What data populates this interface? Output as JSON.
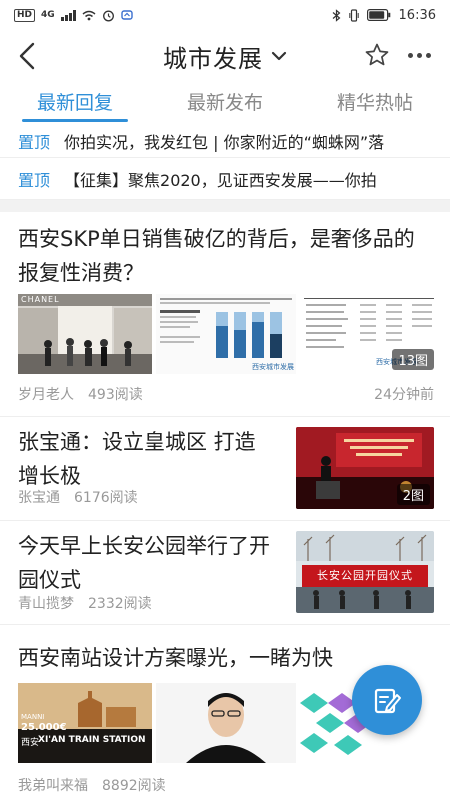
{
  "status_bar": {
    "network_badge": "HD",
    "network_type": "4G",
    "time": "16:36"
  },
  "header": {
    "title": "城市发展",
    "back_icon": "back-arrow-icon",
    "menu_icon": "chevron-down-icon",
    "favorite_icon": "star-icon",
    "more_icon": "more-dots-icon"
  },
  "tabs": [
    {
      "label": "最新回复",
      "active": true
    },
    {
      "label": "最新发布",
      "active": false
    },
    {
      "label": "精华热帖",
      "active": false
    }
  ],
  "pinned": [
    {
      "badge": "置顶",
      "text": "你拍实况，我发红包 | 你家附近的“蜘蛛网”落"
    },
    {
      "badge": "置顶",
      "text": "【征集】聚焦2020，见证西安发展——你拍"
    }
  ],
  "articles": [
    {
      "title": "西安SKP单日销售破亿的背后，是奢侈品的报复性消费？",
      "author": "岁月老人",
      "views": "493阅读",
      "time": "24分钟前",
      "image_count": "13图",
      "thumb_labels": [
        "CHANEL"
      ]
    },
    {
      "title": "张宝通：设立皇城区 打造增长极",
      "author": "张宝通",
      "views": "6176阅读",
      "image_count": "2图"
    },
    {
      "title": "今天早上长安公园举行了开园仪式",
      "author": "青山揽梦",
      "views": "2332阅读",
      "thumb_banner": "长安公园开园仪式"
    },
    {
      "title": "西安南站设计方案曝光，一睹为快",
      "author": "我弟叫来福",
      "views": "8892阅读",
      "thumb_labels": [
        "MANNI",
        "25.000€",
        "XI'AN TRAIN STATION",
        "西安"
      ]
    }
  ],
  "fab": {
    "icon": "edit-post-icon"
  },
  "colors": {
    "accent": "#2f8fd8",
    "meta_gray": "#999999"
  }
}
